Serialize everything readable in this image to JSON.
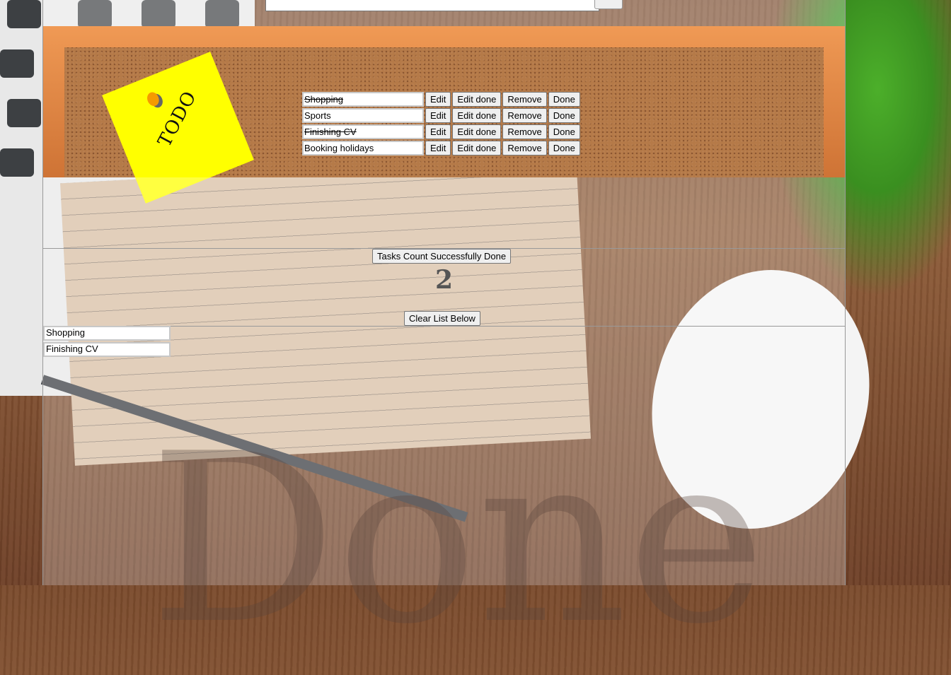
{
  "header": {
    "new_task_value": "",
    "add_button_label": ""
  },
  "sticky_note": {
    "label": "TODO"
  },
  "tasks": [
    {
      "name": "Shopping",
      "done": true
    },
    {
      "name": "Sports",
      "done": false
    },
    {
      "name": "Finishing CV",
      "done": true
    },
    {
      "name": "Booking holidays",
      "done": false
    }
  ],
  "task_buttons": {
    "edit": "Edit",
    "edit_done": "Edit done",
    "remove": "Remove",
    "done": "Done"
  },
  "stats": {
    "title": "Tasks Count Successfully Done",
    "count": "2",
    "clear_label": "Clear List Below"
  },
  "done_list": [
    "Shopping",
    "Finishing CV"
  ],
  "watermark": "Done",
  "colors": {
    "sticky": "#ffff00",
    "frame": "#e08a48"
  }
}
